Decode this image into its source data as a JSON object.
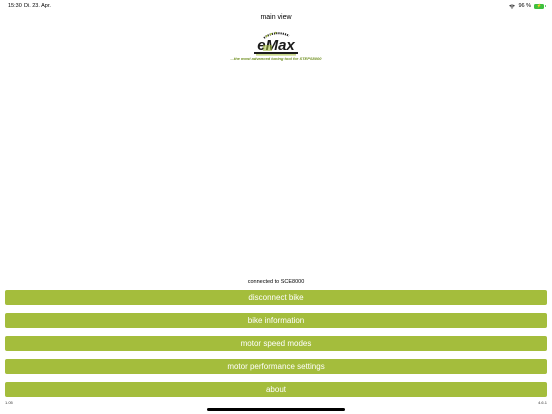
{
  "status_bar": {
    "time": "15:30",
    "date": "Di. 23. Apr.",
    "battery_percent": "96 %",
    "battery_level": 0.96,
    "battery_color": "#3ec13e"
  },
  "nav": {
    "title": "main view"
  },
  "logo": {
    "text": "eMax",
    "tagline": "...the most advanced tuning tool for STEPS8000"
  },
  "connection_status": "connected to SCE8000",
  "menu": [
    {
      "label": "disconnect bike"
    },
    {
      "label": "bike information"
    },
    {
      "label": "motor speed modes"
    },
    {
      "label": "motor performance settings"
    },
    {
      "label": "about"
    }
  ],
  "footer": {
    "left": "1.05",
    "right": "4.6.1"
  },
  "colors": {
    "accent": "#a4bd3c",
    "tagline": "#6e8e1e"
  }
}
